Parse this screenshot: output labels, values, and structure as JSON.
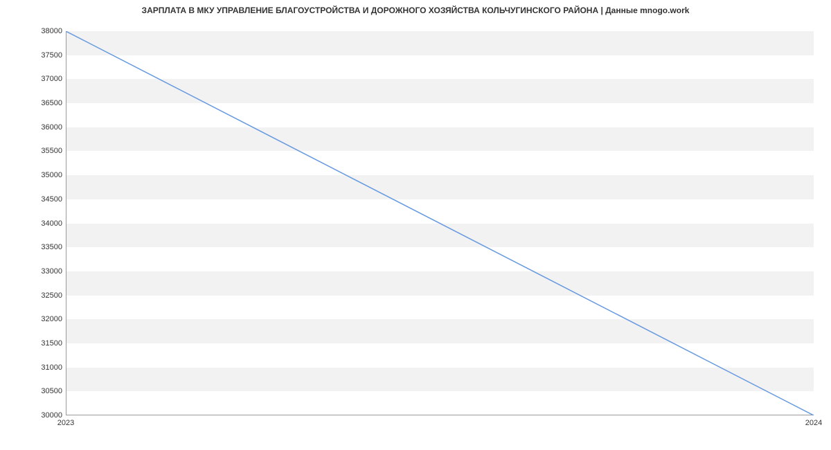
{
  "chart_data": {
    "type": "line",
    "title": "ЗАРПЛАТА В МКУ УПРАВЛЕНИЕ БЛАГОУСТРОЙСТВА И ДОРОЖНОГО ХОЗЯЙСТВА КОЛЬЧУГИНСКОГО РАЙОНА | Данные mnogo.work",
    "x": [
      2023,
      2024
    ],
    "values": [
      38000,
      30000
    ],
    "xlabel": "",
    "ylabel": "",
    "xlim": [
      2023,
      2024
    ],
    "ylim": [
      30000,
      38000
    ],
    "x_ticks": [
      2023,
      2024
    ],
    "y_ticks": [
      30000,
      30500,
      31000,
      31500,
      32000,
      32500,
      33000,
      33500,
      34000,
      34500,
      35000,
      35500,
      36000,
      36500,
      37000,
      37500,
      38000
    ],
    "line_color": "#6699e0"
  }
}
